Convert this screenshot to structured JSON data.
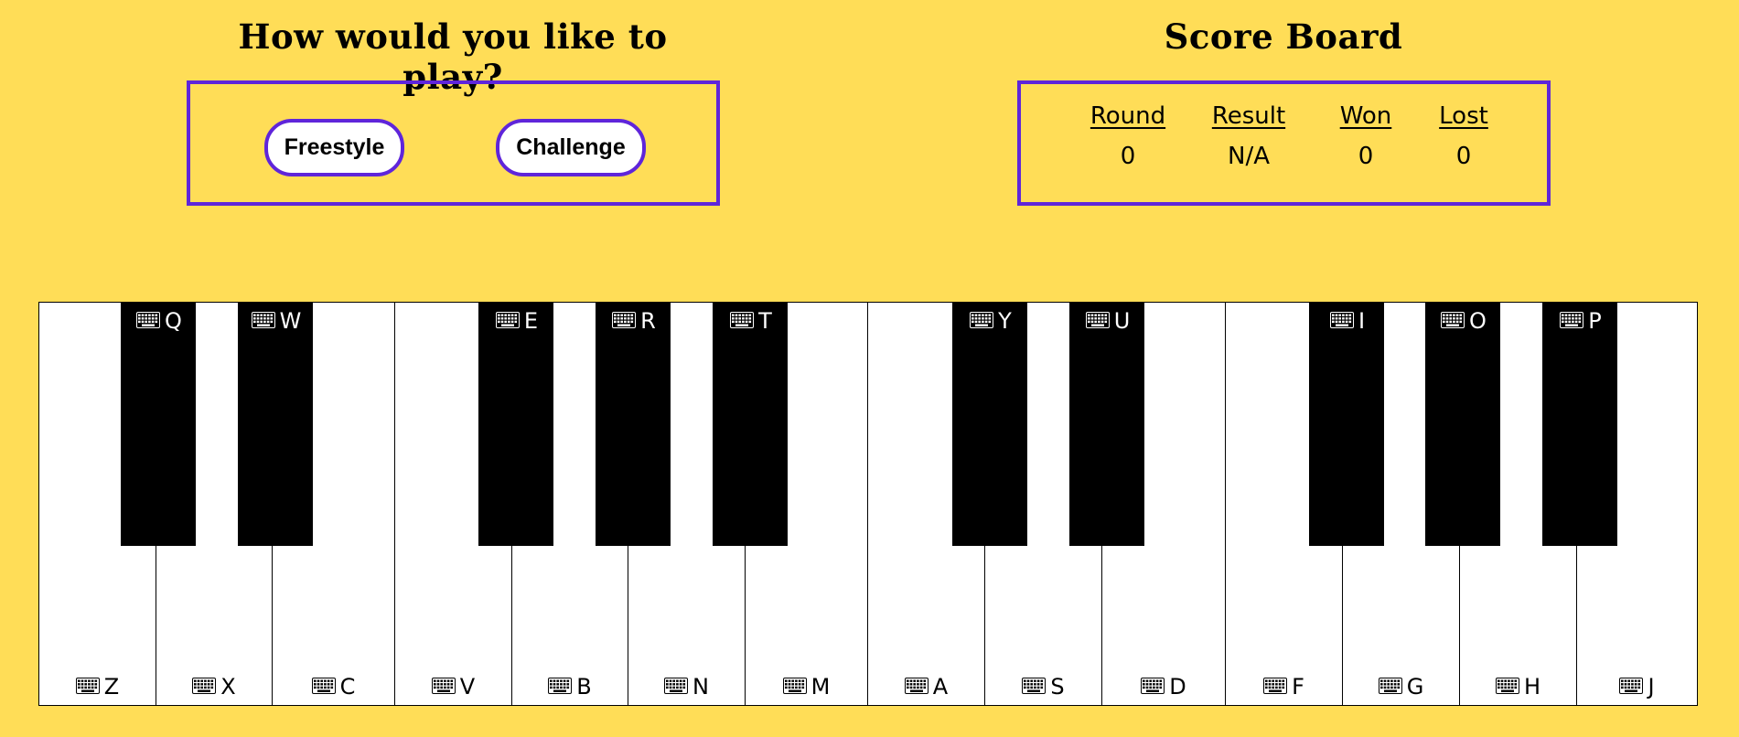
{
  "play_section": {
    "heading": "How would you like to play?",
    "freestyle_label": "Freestyle",
    "challenge_label": "Challenge"
  },
  "score_section": {
    "heading": "Score Board",
    "columns": [
      {
        "header": "Round",
        "value": "0"
      },
      {
        "header": "Result",
        "value": "N/A"
      },
      {
        "header": "Won",
        "value": "0"
      },
      {
        "header": "Lost",
        "value": "0"
      }
    ]
  },
  "piano": {
    "key_icon": "keyboard-icon",
    "white_keys": [
      "Z",
      "X",
      "C",
      "V",
      "B",
      "N",
      "M",
      "A",
      "S",
      "D",
      "F",
      "G",
      "H",
      "J"
    ],
    "black_keys": [
      "Q",
      "W",
      "E",
      "R",
      "T",
      "Y",
      "U",
      "I",
      "O",
      "P"
    ]
  },
  "colors": {
    "background": "#ffdd57",
    "accent_border": "#5f25da",
    "white_key": "#ffffff",
    "black_key": "#000000"
  }
}
